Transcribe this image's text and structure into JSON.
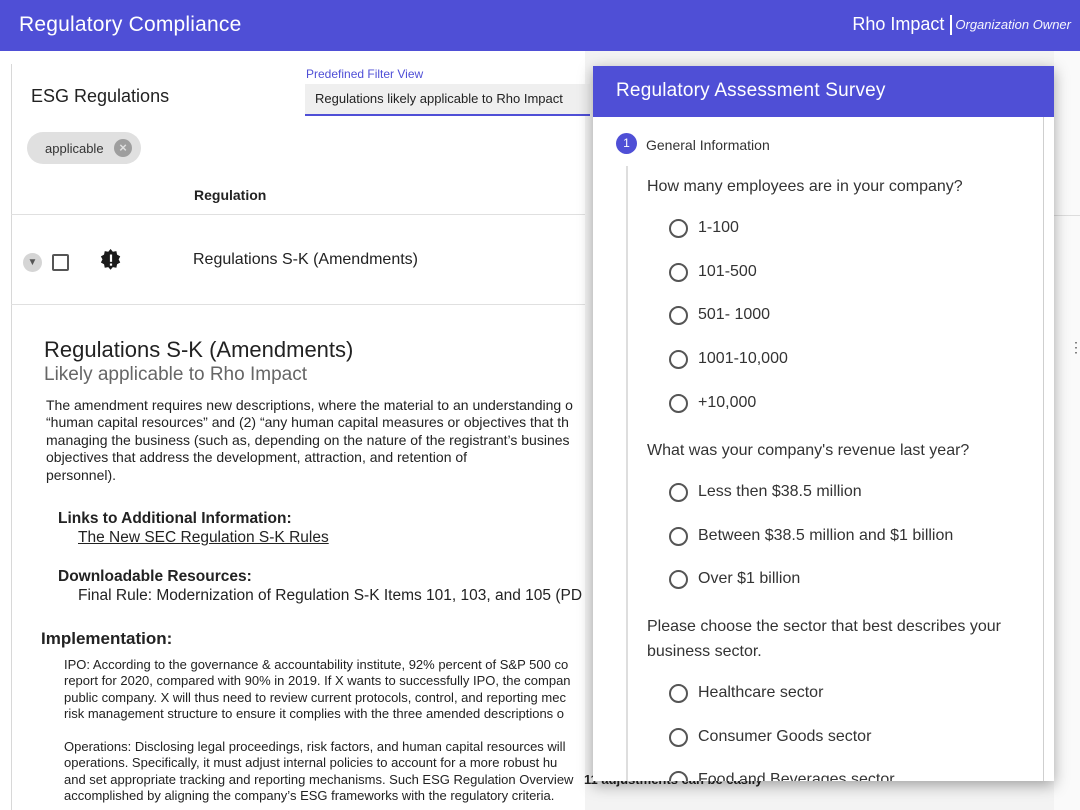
{
  "app": {
    "title": "Regulatory Compliance",
    "org_name": "Rho Impact",
    "org_role": "Organization Owner",
    "brand_color": "#4f4fd6"
  },
  "regulations_panel": {
    "title": "ESG Regulations",
    "filter_label": "Predefined Filter View",
    "filter_value": "Regulations likely applicable to Rho Impact",
    "chip_label": "applicable",
    "column_header": "Regulation",
    "rows": [
      {
        "name": "Regulations S-K (Amendments)",
        "badge_icon": "alert-badge-icon"
      }
    ]
  },
  "detail": {
    "title": "Regulations S-K (Amendments)",
    "subtitle": "Likely applicable to Rho Impact",
    "body_lines": [
      "The amendment requires new descriptions, where the material to an understanding o",
      "“human capital resources” and (2) “any human capital measures or objectives that th",
      "managing the business (such as, depending on the nature of the registrant’s busines",
      "objectives that address the development, attraction, and retention of",
      "personnel)."
    ],
    "links_heading": "Links to Additional Information:",
    "link_text": "The New SEC Regulation S-K Rules",
    "downloads_heading": "Downloadable Resources:",
    "download_text": "Final Rule: Modernization of Regulation S-K Items 101, 103, and 105 (PD",
    "implementation_heading": "Implementation:",
    "impl_para1": [
      "IPO: According to the governance & accountability institute, 92% percent of S&P 500 co",
      "report for 2020, compared with 90% in 2019. If X wants to successfully IPO, the compan",
      "public company. X will thus need to review current protocols, control, and reporting mec",
      "risk management structure to ensure it complies with the three amended descriptions o"
    ],
    "impl_para2": [
      "Operations: Disclosing legal proceedings, risk factors, and human capital resources will",
      "operations. Specifically, it must adjust internal policies to account for a more robust hu",
      "and set appropriate tracking and reporting mechanisms. Such ESG Regulation Overview",
      "accomplished by aligning the company’s ESG frameworks with the regulatory criteria."
    ],
    "impl_tail": "11 adjustments can be easily"
  },
  "survey": {
    "title": "Regulatory Assessment Survey",
    "step_number": "1",
    "step_label": "General Information",
    "questions": [
      {
        "text": "How many employees are in your company?",
        "options": [
          "1-100",
          "101-500",
          "501- 1000",
          "1001-10,000",
          "+10,000"
        ]
      },
      {
        "text": "What was your company's revenue last year?",
        "options": [
          "Less then $38.5 million",
          "Between $38.5 million and $1 billion",
          "Over $1 billion"
        ]
      },
      {
        "text": "Please choose the sector that best describes your business sector.",
        "options": [
          "Healthcare sector",
          "Consumer Goods sector",
          "Food and Beverages sector"
        ]
      }
    ]
  }
}
